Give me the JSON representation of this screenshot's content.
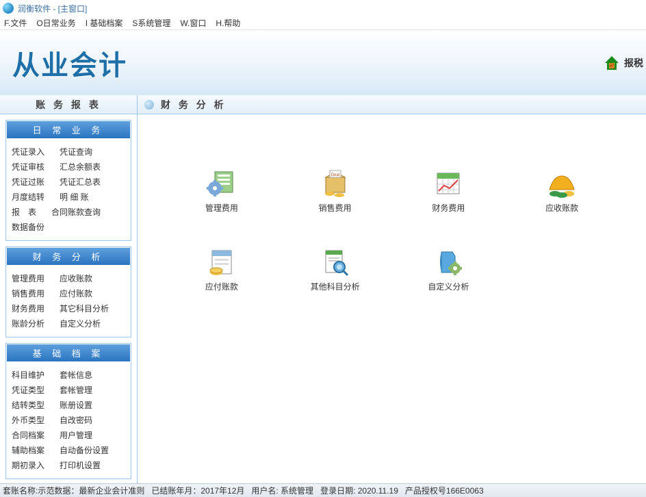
{
  "window": {
    "title": "润衡软件 - [主窗口]"
  },
  "menu": {
    "file": "F.文件",
    "daily": "O日常业务",
    "base": "I 基础档案",
    "system": "S系统管理",
    "window": "W.窗口",
    "help": "H.帮助"
  },
  "brand": {
    "title": "从业会计",
    "tax_label": "报税"
  },
  "sidebar": {
    "title": "账 务 报 表",
    "panels": {
      "daily": {
        "head": "日 常 业 务",
        "rows": [
          [
            "凭证录入",
            "凭证查询"
          ],
          [
            "凭证审核",
            "汇总余额表"
          ],
          [
            "凭证过账",
            "凭证汇总表"
          ],
          [
            "月度结转",
            "明 细 账"
          ],
          [
            "报　表",
            "合同账款查询"
          ],
          [
            "数据备份"
          ]
        ]
      },
      "analysis": {
        "head": "财 务 分 析",
        "rows": [
          [
            "管理费用",
            "应收账款"
          ],
          [
            "销售费用",
            "应付账款"
          ],
          [
            "财务费用",
            "其它科目分析"
          ],
          [
            "账龄分析",
            "自定义分析"
          ]
        ]
      },
      "base": {
        "head": "基 础 档 案",
        "rows": [
          [
            "科目维护",
            "套帐信息"
          ],
          [
            "凭证类型",
            "套帐管理"
          ],
          [
            "结转类型",
            "账册设置"
          ],
          [
            "外币类型",
            "自改密码"
          ],
          [
            "合同档案",
            "用户管理"
          ],
          [
            "辅助档案",
            "自动备份设置"
          ],
          [
            "期初录入",
            "打印机设置"
          ]
        ]
      }
    }
  },
  "content": {
    "title": "财 务 分 析",
    "icons": [
      {
        "name": "管理费用",
        "icon": "gear-sheet"
      },
      {
        "name": "销售费用",
        "icon": "deal-package"
      },
      {
        "name": "财务费用",
        "icon": "calendar-sheet"
      },
      {
        "name": "应收账款",
        "icon": "coins-amber"
      },
      {
        "name": "应付账款",
        "icon": "file-money"
      },
      {
        "name": "其他科目分析",
        "icon": "file-magnify"
      },
      {
        "name": "自定义分析",
        "icon": "file-gear-blue"
      }
    ]
  },
  "status": {
    "acct": "套账名称:示范数据：最新企业会计准则",
    "period": "已结账年月：2017年12月",
    "user": "用户名: 系统管理",
    "login": "登录日期: 2020.11.19",
    "license": "产品授权号166E0063"
  }
}
